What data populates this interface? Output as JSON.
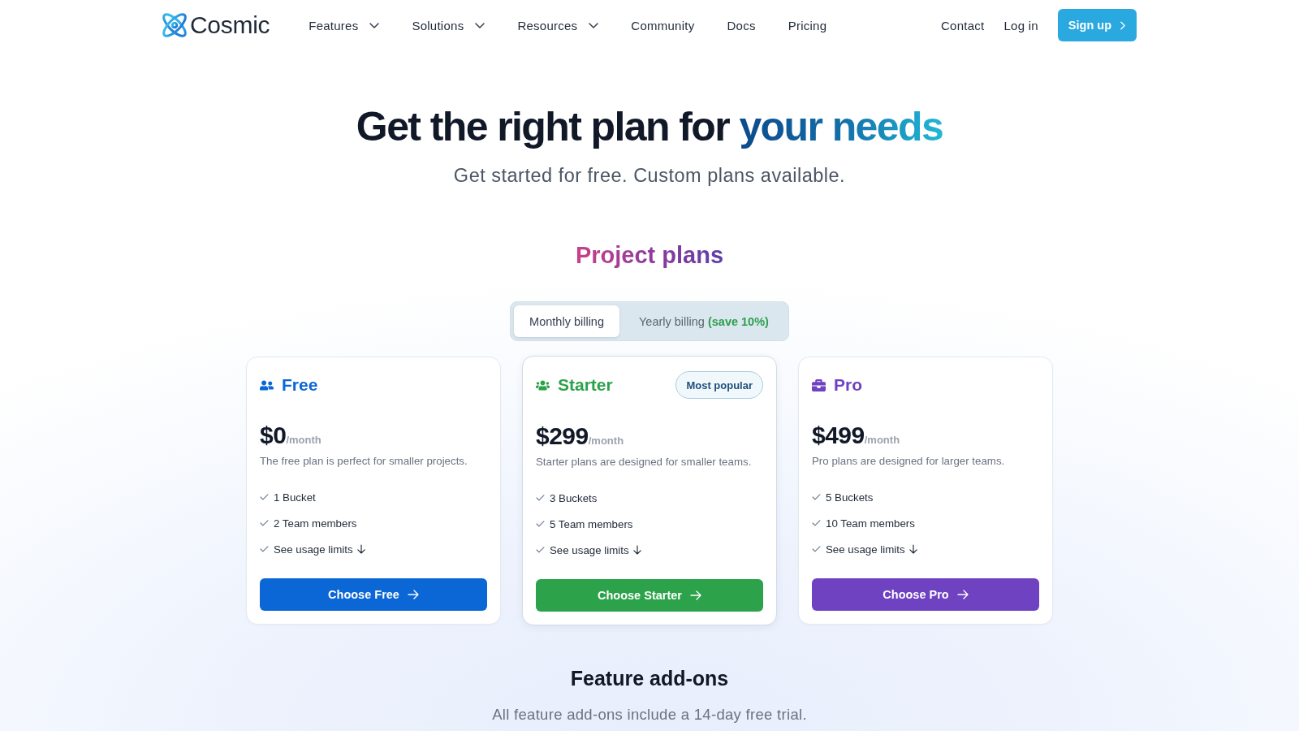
{
  "nav": {
    "logo": "Cosmic",
    "links": [
      {
        "label": "Features",
        "dropdown": true
      },
      {
        "label": "Solutions",
        "dropdown": true
      },
      {
        "label": "Resources",
        "dropdown": true
      },
      {
        "label": "Community",
        "dropdown": false
      },
      {
        "label": "Docs",
        "dropdown": false
      },
      {
        "label": "Pricing",
        "dropdown": false
      }
    ],
    "actions": [
      {
        "label": "Contact",
        "kind": "link"
      },
      {
        "label": "Log in",
        "kind": "link"
      },
      {
        "label": "Sign up",
        "kind": "button"
      }
    ]
  },
  "hero": {
    "title": "Get the right plan for",
    "title_highlight": "your needs",
    "subtitle": "Get started for free. Custom plans available."
  },
  "plans_section": {
    "title": "Project plans",
    "billing": [
      {
        "label": "Monthly billing",
        "selected": true
      },
      {
        "label": "Yearly billing",
        "note": "(save 10%)",
        "selected": false
      }
    ]
  },
  "plans": [
    {
      "kind": "free",
      "name": "Free",
      "color": "#0b66d6",
      "price": "$0",
      "period": "/month",
      "description": "The free plan is perfect for smaller projects.",
      "features": [
        {
          "label": "1 Bucket",
          "kind": "item"
        },
        {
          "label": "2 Team members",
          "kind": "item"
        },
        {
          "label": "See usage limits",
          "kind": "link"
        }
      ],
      "cta": "Choose Free"
    },
    {
      "kind": "starter",
      "name": "Starter",
      "color": "#2ca24a",
      "badge": "Most popular",
      "price": "$299",
      "period": "/month",
      "description": "Starter plans are designed for smaller teams.",
      "features": [
        {
          "label": "3 Buckets",
          "kind": "item"
        },
        {
          "label": "5 Team members",
          "kind": "item"
        },
        {
          "label": "See usage limits",
          "kind": "link"
        }
      ],
      "cta": "Choose Starter"
    },
    {
      "kind": "pro",
      "name": "Pro",
      "color": "#6f42c1",
      "price": "$499",
      "period": "/month",
      "description": "Pro plans are designed for larger teams.",
      "features": [
        {
          "label": "5 Buckets",
          "kind": "item"
        },
        {
          "label": "10 Team members",
          "kind": "item"
        },
        {
          "label": "See usage limits",
          "kind": "link"
        }
      ],
      "cta": "Choose Pro"
    }
  ],
  "addons": {
    "title": "Feature add-ons",
    "subtitle": "All feature add-ons include a 14-day free trial."
  }
}
